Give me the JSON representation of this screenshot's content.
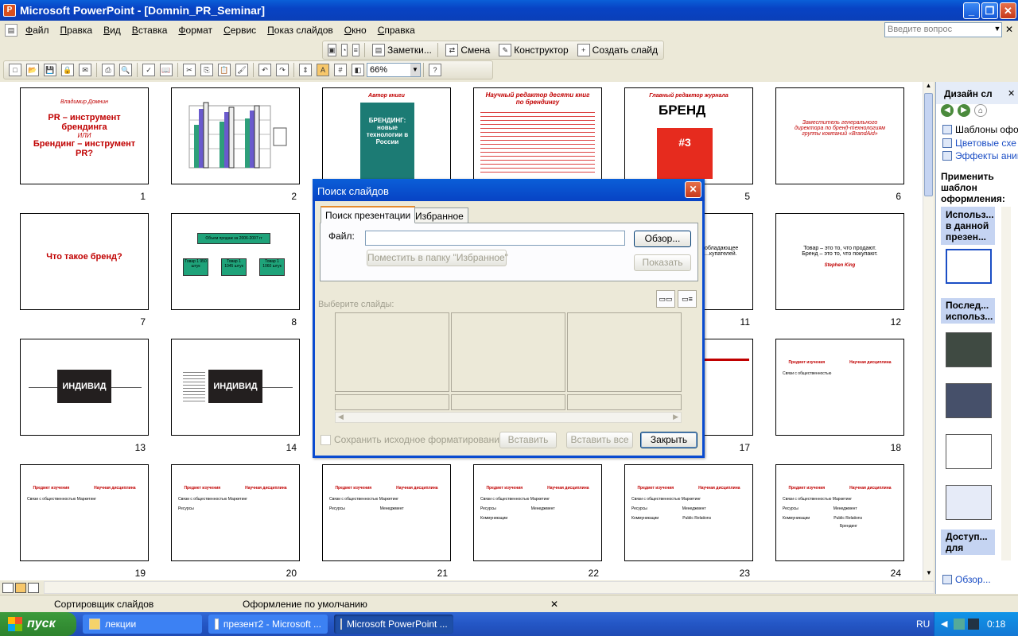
{
  "window": {
    "title": "Microsoft PowerPoint - [Domnin_PR_Seminar]",
    "min": "_",
    "max": "❐",
    "close": "✕"
  },
  "menu": [
    "Файл",
    "Правка",
    "Вид",
    "Вставка",
    "Формат",
    "Сервис",
    "Показ слайдов",
    "Окно",
    "Справка"
  ],
  "help_box": {
    "placeholder": "Введите вопрос"
  },
  "toolbar_top": {
    "notes": "Заметки...",
    "transition": "Смена",
    "designer": "Конструктор",
    "new_slide": "Создать слайд"
  },
  "toolbar_std": {
    "zoom": "66%"
  },
  "slides": [
    {
      "n": "1",
      "author": "Владимир Домнин",
      "title": "PR – инструмент брендинга",
      "or": "ИЛИ",
      "title2": "Брендинг – инструмент PR?"
    },
    {
      "n": "2"
    },
    {
      "n": "3",
      "header": "Автор книги",
      "book": "БРЕНДИНГ: новые технологии в России"
    },
    {
      "n": "4",
      "header": "Научный редактор десяти книг по брендингу"
    },
    {
      "n": "5",
      "header": "Главный редактор журнала",
      "brand": "БРЕНД",
      "num": "#3"
    },
    {
      "n": "6",
      "text": "Заместитель генерального директора по бренд-технологиям группы компаний «BrandAid»"
    },
    {
      "n": "7",
      "text": "Что такое бренд?"
    },
    {
      "n": "8",
      "top": "Объем продаж за 2006-2007 гг",
      "boxes": [
        "Товар 1 950 штук",
        "Товар 1 1045 штук",
        "Товар 1 1060 штук"
      ]
    },
    {
      "n": "11",
      "text": "обладающее ...купателей."
    },
    {
      "n": "12",
      "line1": "Товар – это то, что продают.",
      "line2": "Бренд – это то, что покупают.",
      "sig": "Stephen King"
    },
    {
      "n": "13",
      "box": "ИНДИВИД"
    },
    {
      "n": "14",
      "box": "ИНДИВИД"
    },
    {
      "n": "17"
    },
    {
      "n": "18",
      "h1": "Предмет изучения",
      "h2": "Научная дисциплина",
      "r1": "Связи с общественностью"
    },
    {
      "n": "19"
    },
    {
      "n": "20"
    },
    {
      "n": "21"
    },
    {
      "n": "22"
    },
    {
      "n": "23"
    },
    {
      "n": "24"
    }
  ],
  "slide_body": {
    "h1": "Предмет изучения",
    "h2": "Научная дисциплина",
    "r1a": "Связи с общественностью",
    "r1b": "Маркетинг",
    "r2a": "Ресурсы",
    "r2b": "Менеджмент",
    "r3a": "Коммуникации",
    "r3b": "Public Relations",
    "r4b": "Брендинг"
  },
  "task_pane": {
    "title": "Дизайн сл",
    "links": [
      "Шаблоны офо",
      "Цветовые схе",
      "Эффекты аним"
    ],
    "apply": "Применить шаблон оформления:",
    "sect1": "Использ... в данной презен...",
    "sect2": "Послед... использ...",
    "sect3": "Доступ... для",
    "browse": "Обзор..."
  },
  "status": {
    "view": "Сортировщик слайдов",
    "design": "Оформление по умолчанию"
  },
  "dialog": {
    "title": "Поиск слайдов",
    "tab1": "Поиск презентации",
    "tab2": "Избранное",
    "file_label": "Файл:",
    "browse": "Обзор...",
    "add_fav": "Поместить в папку \"Избранное\"",
    "show": "Показать",
    "select_label": "Выберите слайды:",
    "keep_format": "Сохранить исходное форматирование",
    "insert": "Вставить",
    "insert_all": "Вставить все",
    "close": "Закрыть"
  },
  "taskbar": {
    "start": "пуск",
    "tasks": [
      "лекции",
      "презент2 - Microsoft ...",
      "Microsoft PowerPoint ..."
    ],
    "lang": "RU",
    "clock": "0:18"
  }
}
